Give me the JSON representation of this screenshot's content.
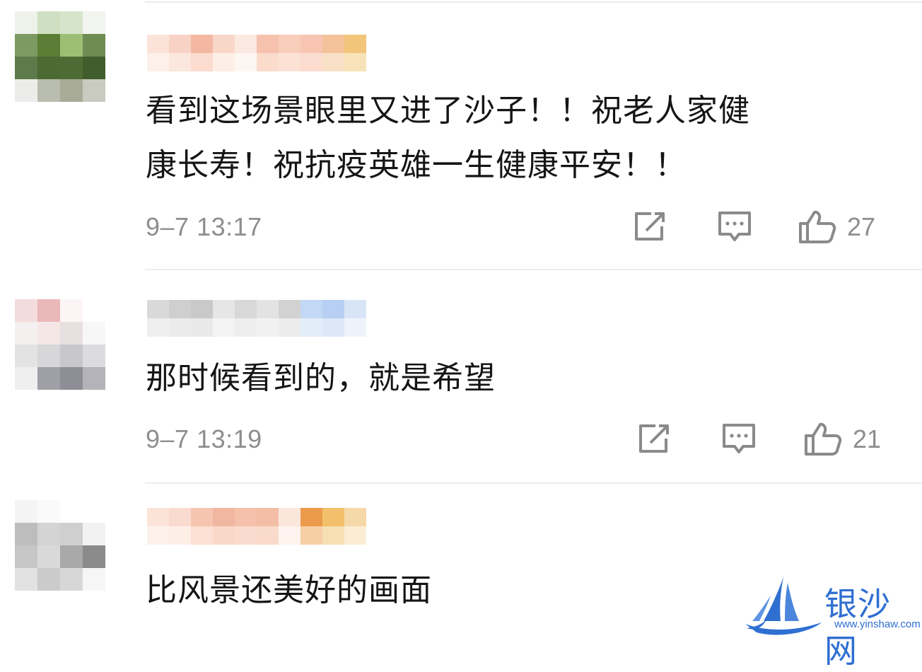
{
  "comments": [
    {
      "text_line1": "看到这场景眼里又进了沙子！！祝老人家健",
      "text_line2": "康长寿！祝抗疫英雄一生健康平安！！",
      "timestamp": "9–7 13:17",
      "likes": "27",
      "avatar_pixels": [
        "#eef2ea",
        "#cfe0c2",
        "#d6e4cc",
        "#f2f4ef",
        "#7d9a62",
        "#5b7e36",
        "#9dbf73",
        "#6f8c53",
        "#5f7a4a",
        "#4d6a33",
        "#4f6b35",
        "#425d2c",
        "#ececea",
        "#b9bdb0",
        "#a7ab97",
        "#c9cbc0"
      ],
      "username_pixels": [
        "#fbe3da",
        "#fdf0ea",
        "#f8d3c5",
        "#fce7de",
        "#f4b8a2",
        "#fbdccf",
        "#f9d7c8",
        "#fdeee6",
        "#fbe9e1",
        "#fef6f2",
        "#f6c2ae",
        "#fadbcc",
        "#f8cdb9",
        "#fbe2d5",
        "#f7c5b2",
        "#fbdccf",
        "#f3c29a",
        "#f9e1c8",
        "#f1c57a",
        "#f8e2b8"
      ]
    },
    {
      "text_line1": "那时候看到的，就是希望",
      "timestamp": "9–7 13:19",
      "likes": "21",
      "avatar_pixels": [
        "#f3dcdc",
        "#ebb8ba",
        "#fdf5f5",
        "#ffffff",
        "#f4f0f0",
        "#f6e7e7",
        "#e7dfe0",
        "#f7f7f7",
        "#e3e3e4",
        "#d7d7d9",
        "#c8c8cc",
        "#dcdcdf",
        "#efeff0",
        "#9f9fa6",
        "#8e8e97",
        "#b3b3b9"
      ],
      "username_pixels": [
        "#d9d9d9",
        "#efefef",
        "#cfcfcf",
        "#ebebeb",
        "#c9c9c9",
        "#e9e9e9",
        "#e6e6e6",
        "#f3f3f3",
        "#d8d8d8",
        "#eeeeee",
        "#e3e3e3",
        "#f1f1f1",
        "#d2d2d2",
        "#ececec",
        "#c3d8f4",
        "#e3edfa",
        "#b6cff2",
        "#dce8f8",
        "#d8e5f7",
        "#eef3fb"
      ]
    },
    {
      "text_line1": "比风景还美好的画面",
      "avatar_pixels": [
        "#f4f4f4",
        "#fafafa",
        "#ffffff",
        "#ffffff",
        "#bdbdbd",
        "#d4d4d4",
        "#cfcfcf",
        "#f2f2f2",
        "#c6c6c6",
        "#d9d9d9",
        "#a9a9a9",
        "#8a8a8a",
        "#e2e2e2",
        "#cbcbcb",
        "#d7d7d7",
        "#f6f6f6"
      ],
      "username_pixels": [
        "#fbe3d8",
        "#fdf1eb",
        "#f9dccf",
        "#fdeee6",
        "#f6c5b0",
        "#fbe0d3",
        "#f2b7a0",
        "#f9d8c9",
        "#f5c1ab",
        "#fadbcd",
        "#f3bda6",
        "#f9dacb",
        "#fbe6dc",
        "#fef3ee",
        "#ec9b4c",
        "#f6cfa6",
        "#f2c06a",
        "#f8dfb3",
        "#f6d9a8",
        "#fbecd4"
      ]
    }
  ],
  "watermark": {
    "name": "银沙网",
    "url": "www.yinshaw.com"
  },
  "colors": {
    "text": "#151515",
    "muted": "#8e8e8e",
    "divider": "#ececec",
    "watermark_blue": "#2f6fd1"
  },
  "icons": [
    "share-icon",
    "comment-icon",
    "like-icon",
    "watermark-logo-icon"
  ]
}
